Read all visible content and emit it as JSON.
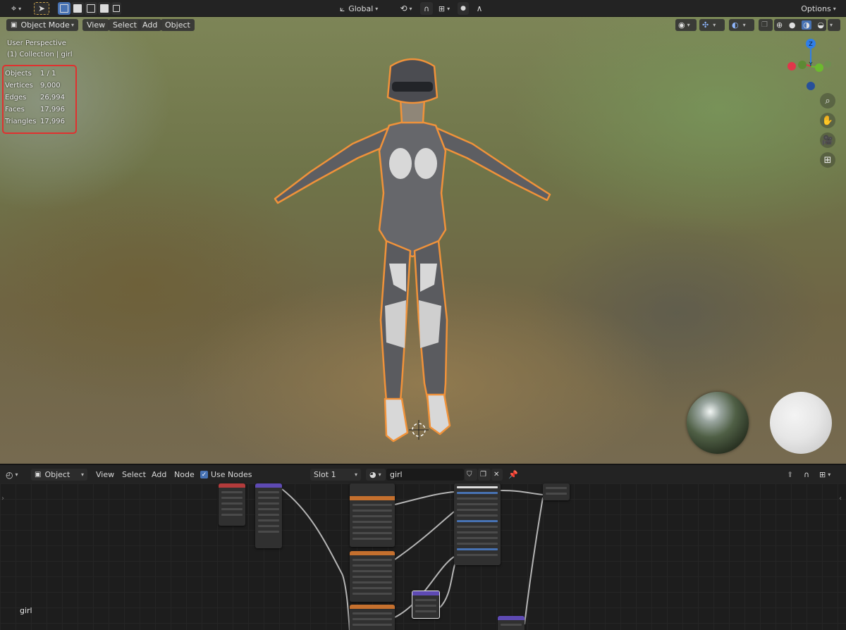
{
  "header": {
    "transform_orientation": "Global",
    "options_label": "Options"
  },
  "viewport": {
    "mode_label": "Object Mode",
    "menus": [
      "View",
      "Select",
      "Add",
      "Object"
    ],
    "perspective": "User Perspective",
    "collection": "(1) Collection | girl",
    "stats": [
      {
        "label": "Objects",
        "value": "1 / 1"
      },
      {
        "label": "Vertices",
        "value": "9,000"
      },
      {
        "label": "Edges",
        "value": "26,994"
      },
      {
        "label": "Faces",
        "value": "17,996"
      },
      {
        "label": "Triangles",
        "value": "17,996"
      }
    ],
    "gizmo_axes": {
      "z": "Z",
      "y": "Y"
    },
    "colors": {
      "x_axis": "#e0364a",
      "y_axis": "#6cba2e",
      "z_axis": "#2f7ee8",
      "selection_outline": "#f0923a",
      "stats_highlight": "#e0312f"
    }
  },
  "node_editor": {
    "editor_type": "Object",
    "menus": [
      "View",
      "Select",
      "Add",
      "Node"
    ],
    "use_nodes_label": "Use Nodes",
    "use_nodes_checked": true,
    "slot": "Slot 1",
    "material_name": "girl",
    "canvas_label": "girl"
  }
}
